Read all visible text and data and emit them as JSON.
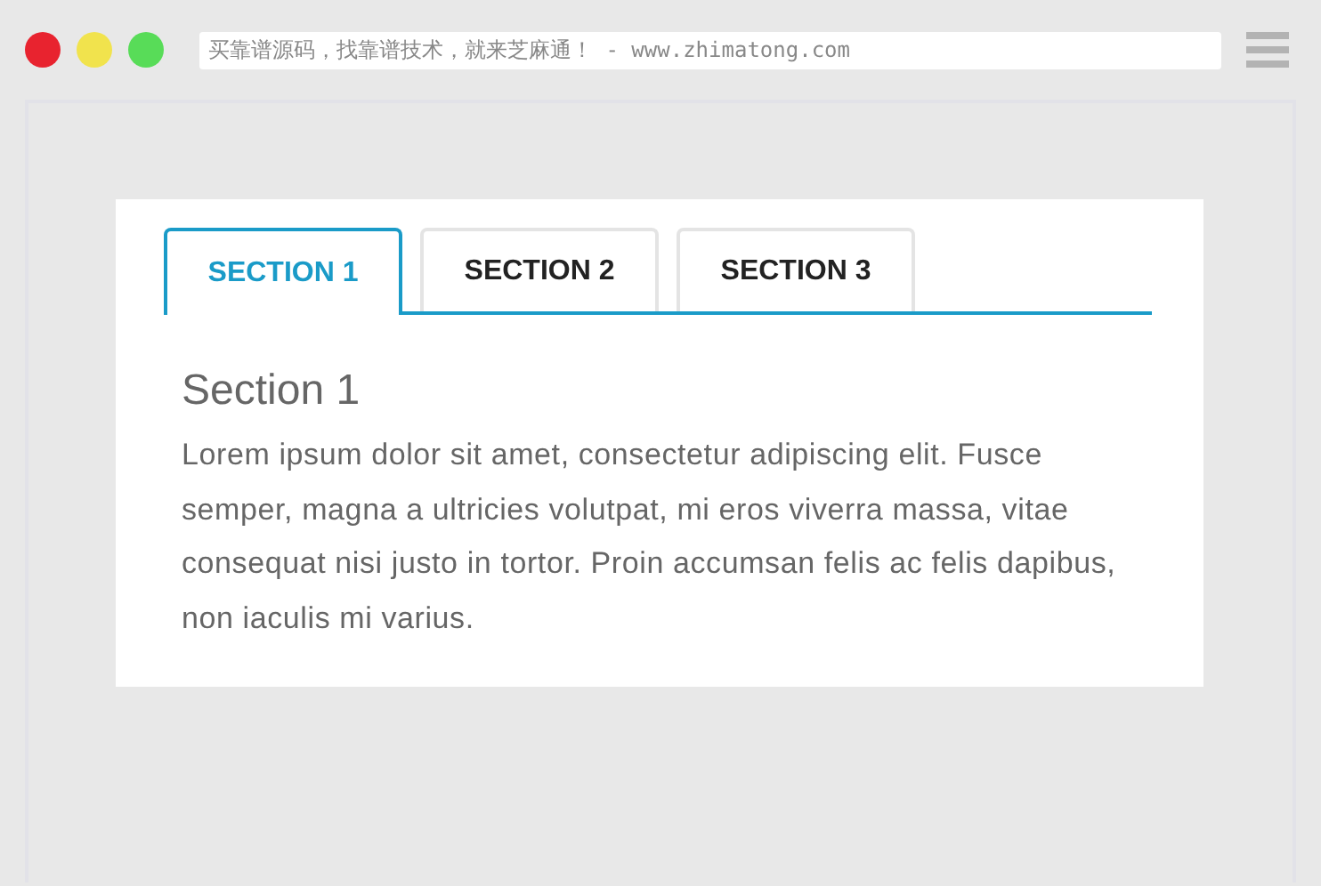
{
  "browser": {
    "address": "买靠谱源码，找靠谱技术，就来芝麻通！ - www.zhimatong.com"
  },
  "tabs": [
    {
      "label": "SECTION 1",
      "selected": true
    },
    {
      "label": "SECTION 2",
      "selected": false
    },
    {
      "label": "SECTION 3",
      "selected": false
    }
  ],
  "content": {
    "heading": "Section 1",
    "body": "Lorem ipsum dolor sit amet, consectetur adipiscing elit. Fusce semper, magna a ultricies volutpat, mi eros viverra massa, vitae consequat nisi justo in tortor. Proin accumsan felis ac felis dapibus, non iaculis mi varius."
  }
}
